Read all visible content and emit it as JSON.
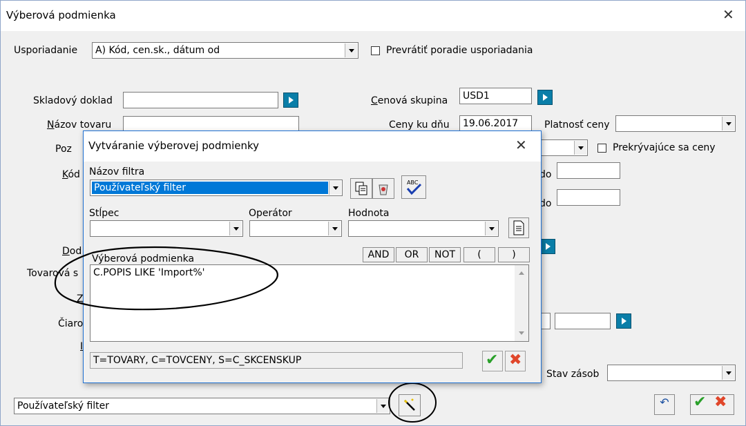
{
  "window": {
    "title": "Výberová podmienka"
  },
  "sort": {
    "label": "Usporiadanie",
    "value": "A) Kód, cen.sk., dátum od",
    "reverse_label": "Prevrátiť poradie usporiadania"
  },
  "fields": {
    "skladovy_doklad": "Skladový doklad",
    "nazov_tovaru": "Názov tovaru",
    "poz": "Poz",
    "kod": "Kód",
    "dod": "Dod",
    "tovarova": "Tovarová s",
    "z": "Z",
    "ciaro": "Čiaro",
    "i": "I",
    "cenova_skupina": "Cenová skupina",
    "cenova_skupina_value": "USD1",
    "ceny_ku_dnu": "Ceny ku dňu",
    "ceny_ku_dnu_value": "19.06.2017",
    "platnost_ceny": "Platnosť ceny",
    "prekryvajuce": "Prekrývajúce sa ceny",
    "do1": "do",
    "do2": "do",
    "stav_zasob": "Stav zásob"
  },
  "bottom": {
    "filter_value": "Používateľský filter"
  },
  "dialog": {
    "title": "Vytváranie výberovej podmienky",
    "filter_name_label": "Názov filtra",
    "filter_name_value": "Používateľský filter",
    "column_label": "Stĺpec",
    "operator_label": "Operátor",
    "value_label": "Hodnota",
    "condition_label": "Výberová podmienka",
    "condition_text": "C.POPIS LIKE 'Import%'",
    "ops": [
      "AND",
      "OR",
      "NOT",
      "(",
      ")"
    ],
    "alias_info": "T=TOVARY, C=TOVCENY, S=C_SKCENSKUP"
  },
  "colors": {
    "accent": "#0078d7",
    "go": "#0a7ea8",
    "ok": "#2aa02a",
    "cancel": "#e0462a"
  }
}
